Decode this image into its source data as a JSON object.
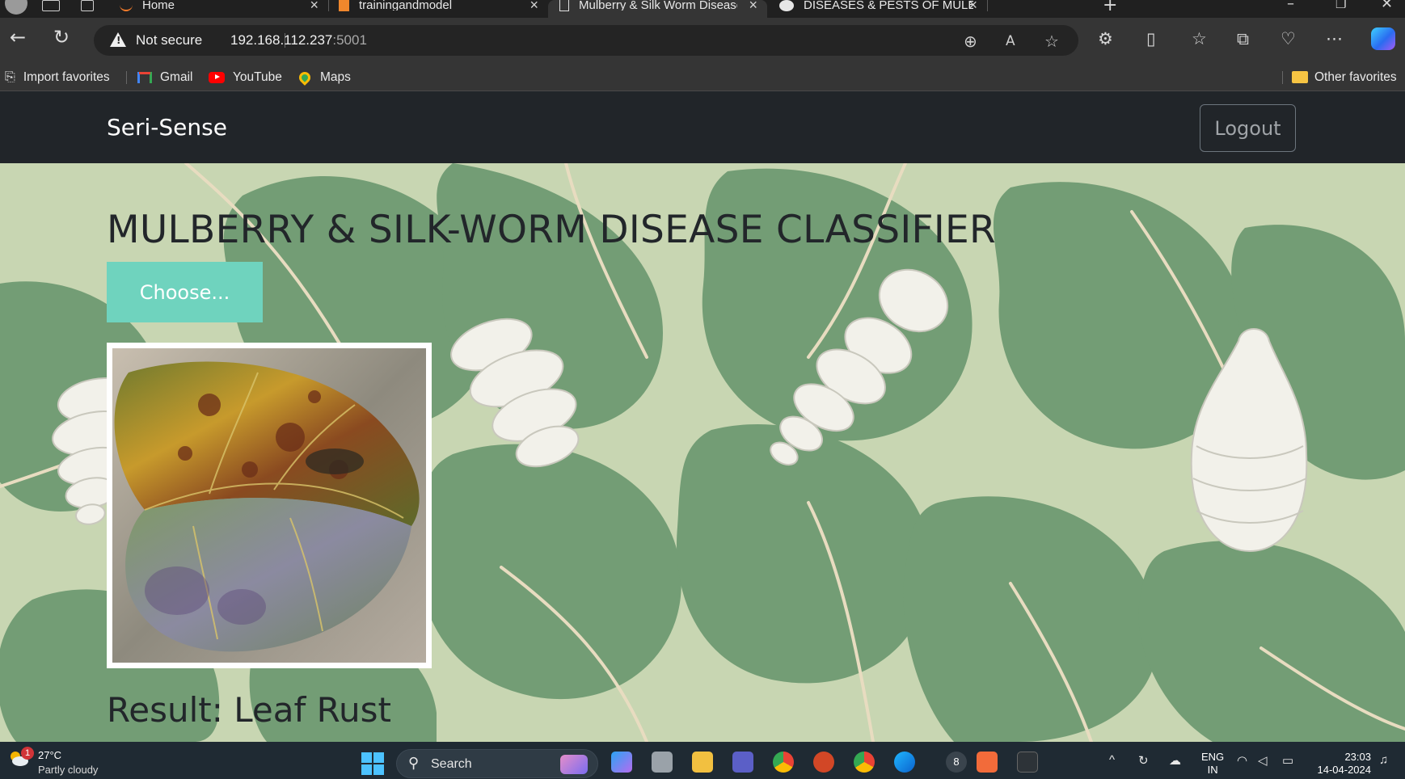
{
  "browser": {
    "tabs": [
      {
        "title": "Home",
        "icon": "loader-icon",
        "active": false
      },
      {
        "title": "trainingandmodel",
        "icon": "notebook-icon",
        "active": false
      },
      {
        "title": "Mulberry & Silk Worm Disease Pr",
        "icon": "page-icon",
        "active": true
      },
      {
        "title": "DISEASES & PESTS OF MULBERR",
        "icon": "wordpress-icon",
        "active": false
      }
    ],
    "security_label": "Not secure",
    "url_host": "192.168.112.237",
    "url_port": ":5001",
    "favorites": [
      {
        "label": "Import favorites",
        "icon": "import-icon"
      },
      {
        "label": "Gmail",
        "icon": "gmail-icon"
      },
      {
        "label": "YouTube",
        "icon": "youtube-icon"
      },
      {
        "label": "Maps",
        "icon": "maps-icon"
      }
    ],
    "other_favorites": "Other favorites"
  },
  "site": {
    "brand": "Seri-Sense",
    "logout_label": "Logout",
    "heading": "MULBERRY & SILK-WORM DISEASE CLASSIFIER",
    "choose_label": "Choose...",
    "result_text": "Result: Leaf Rust",
    "accent_color": "#6fd3be",
    "navbar_color": "#212529"
  },
  "taskbar": {
    "temperature": "27°C",
    "condition": "Partly cloudy",
    "weather_badge": "1",
    "search_label": "Search",
    "lang_top": "ENG",
    "lang_bottom": "IN",
    "time": "23:03",
    "date": "14-04-2024",
    "notification_count": "8"
  }
}
